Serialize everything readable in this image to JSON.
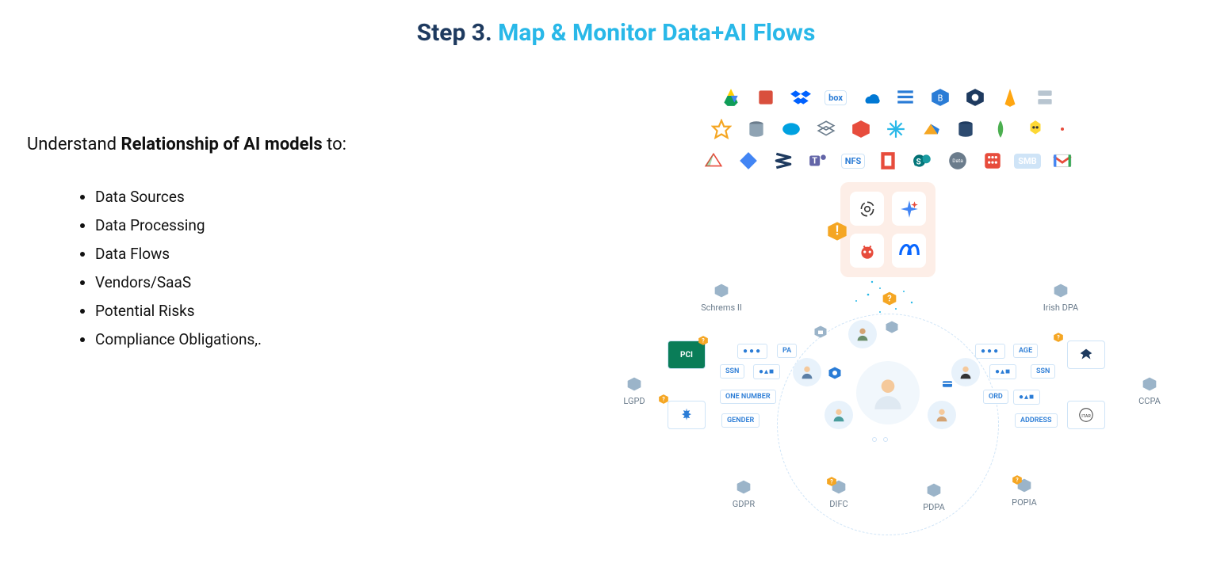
{
  "title": {
    "prefix": "Step 3.",
    "main": "Map & Monitor Data+AI Flows"
  },
  "left": {
    "intro_prefix": "Understand ",
    "intro_bold": "Relationship of AI models",
    "intro_suffix": " to:",
    "bullets": [
      "Data Sources",
      "Data Processing",
      "Data Flows",
      "Vendors/SaaS",
      "Potential Risks",
      "Compliance Obligations,."
    ]
  },
  "grid": {
    "row1_box": "box",
    "nfs": "NFS",
    "smb": "SMB"
  },
  "ai_box": {
    "cells": [
      "openai-icon",
      "sparkle-icon",
      "llama-icon",
      "meta-icon"
    ]
  },
  "regulations": {
    "schrems": "Schrems II",
    "irish": "Irish DPA",
    "lgpd": "LGPD",
    "ccpa": "CCPA",
    "gdpr": "GDPR",
    "difc": "DIFC",
    "pdpa": "PDPA",
    "popia": "POPIA"
  },
  "chips": {
    "ssn": "SSN",
    "pa": "PA",
    "age": "AGE",
    "phone": "ONE NUMBER",
    "ord": "ORD",
    "gender": "GENDER",
    "address": "ADDRESS",
    "ssn2": "SSN"
  },
  "badge_pci": "PCI",
  "badge_itar": "ITAR",
  "colors": {
    "dark": "#1e3a5f",
    "blue": "#29b8e8",
    "hex": "#9bb4c9",
    "orange": "#f5a623",
    "chipBorder": "#cfe4f7"
  }
}
